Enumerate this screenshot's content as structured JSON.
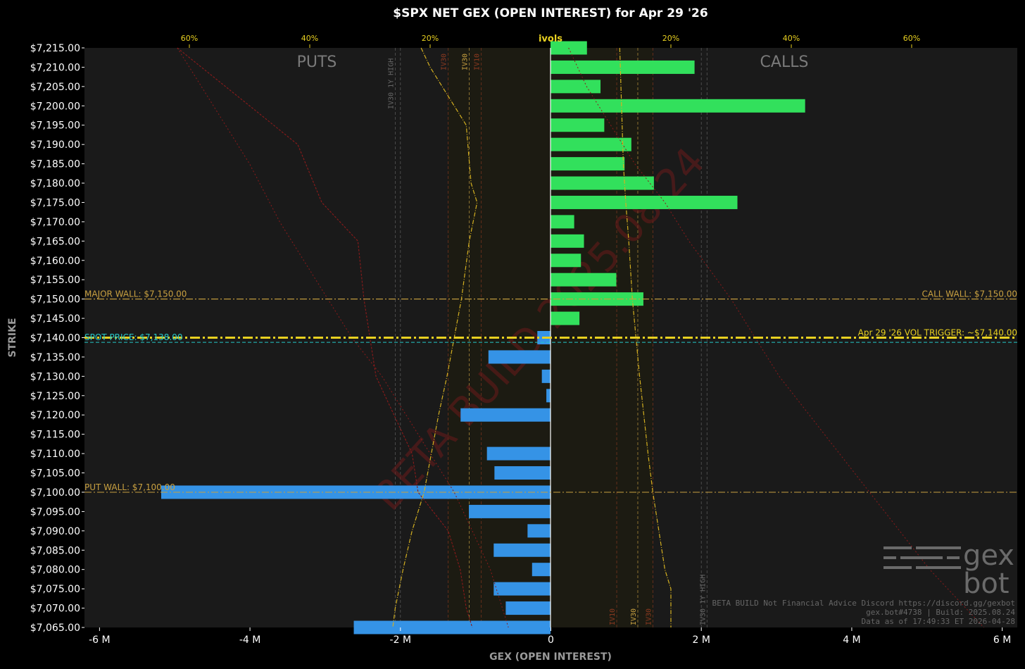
{
  "chart_data": {
    "type": "bar",
    "orientation": "horizontal",
    "title": "$SPX NET GEX (OPEN INTEREST) for Apr 29 '26",
    "xlabel": "GEX (OPEN INTEREST)",
    "ylabel": "STRIKE",
    "xlim": [
      -6200000,
      6200000
    ],
    "xticks": [
      -6000000,
      -4000000,
      -2000000,
      0,
      2000000,
      4000000,
      6000000
    ],
    "xtick_labels": [
      "-6 M",
      "-4 M",
      "-2 M",
      "0",
      "2 M",
      "4 M",
      "6 M"
    ],
    "ylim": [
      7065,
      7215
    ],
    "strike_step": 5,
    "grid": false,
    "side_labels": {
      "left": "PUTS",
      "right": "CALLS"
    },
    "top_axis": {
      "title": "ivols",
      "ticks": [
        {
          "iv": -0.6,
          "label": "60%"
        },
        {
          "iv": -0.4,
          "label": "40%"
        },
        {
          "iv": -0.2,
          "label": "20%"
        },
        {
          "iv": 0.2,
          "label": "20%"
        },
        {
          "iv": 0.4,
          "label": "40%"
        },
        {
          "iv": 0.6,
          "label": "60%"
        }
      ]
    },
    "series": [
      {
        "strikes": [
          7215,
          7210,
          7205,
          7200,
          7195,
          7190,
          7185,
          7180,
          7175,
          7170,
          7165,
          7160,
          7155,
          7150,
          7145,
          7140,
          7135,
          7130,
          7125,
          7120,
          7115,
          7110,
          7105,
          7100,
          7095,
          7090,
          7085,
          7080,
          7075,
          7070,
          7065
        ],
        "values": [
          480000,
          1910000,
          660000,
          3380000,
          710000,
          1070000,
          980000,
          1370000,
          2480000,
          310000,
          440000,
          400000,
          870000,
          1230000,
          380000,
          -180000,
          -830000,
          -120000,
          -60000,
          -1200000,
          0,
          -850000,
          -750000,
          -5180000,
          -1090000,
          -310000,
          -760000,
          -250000,
          -760000,
          -600000,
          -2620000
        ],
        "positive_color": "#32e05c",
        "negative_color": "#3593e6"
      }
    ],
    "levels": [
      {
        "label": "MAJOR WALL: $7,150.00",
        "strike": 7150,
        "side": "left",
        "color": "#c8a040"
      },
      {
        "label": "CALL WALL: $7,150.00",
        "strike": 7150,
        "side": "right",
        "color": "#c8a040"
      },
      {
        "label": "Apr 29 '26 VOL TRIGGER: ~$7,140.00",
        "strike": 7140,
        "side": "right",
        "color": "#e8d020"
      },
      {
        "label": "SPOT PRICE: $7,138.00",
        "strike": 7138.8,
        "side": "left",
        "color": "#25c8c8"
      },
      {
        "label": "PUT WALL: $7,100.00",
        "strike": 7100,
        "side": "left",
        "color": "#c8a040"
      }
    ],
    "iv_curves": {
      "call_ivol": [
        [
          7215,
          0.03
        ],
        [
          7205,
          0.06
        ],
        [
          7195,
          0.1
        ],
        [
          7185,
          0.14
        ],
        [
          7175,
          0.19
        ],
        [
          7165,
          0.23
        ],
        [
          7150,
          0.3
        ],
        [
          7140,
          0.34
        ],
        [
          7130,
          0.38
        ],
        [
          7120,
          0.43
        ],
        [
          7110,
          0.48
        ],
        [
          7100,
          0.53
        ],
        [
          7090,
          0.58
        ],
        [
          7080,
          0.63
        ],
        [
          7070,
          0.69
        ],
        [
          7065,
          0.72
        ]
      ],
      "put_ivol": [
        [
          7215,
          -0.62
        ],
        [
          7200,
          -0.56
        ],
        [
          7185,
          -0.5
        ],
        [
          7170,
          -0.45
        ],
        [
          7160,
          -0.41
        ],
        [
          7150,
          -0.37
        ],
        [
          7140,
          -0.33
        ],
        [
          7130,
          -0.28
        ],
        [
          7120,
          -0.24
        ],
        [
          7110,
          -0.2
        ],
        [
          7100,
          -0.16
        ],
        [
          7090,
          -0.13
        ],
        [
          7080,
          -0.1
        ],
        [
          7065,
          -0.07
        ]
      ],
      "skew_left": [
        [
          7215,
          -0.215
        ],
        [
          7210,
          -0.2
        ],
        [
          7195,
          -0.14
        ],
        [
          7180,
          -0.132
        ],
        [
          7175,
          -0.122
        ],
        [
          7165,
          -0.135
        ],
        [
          7150,
          -0.148
        ],
        [
          7140,
          -0.16
        ],
        [
          7130,
          -0.172
        ],
        [
          7120,
          -0.186
        ],
        [
          7110,
          -0.198
        ],
        [
          7100,
          -0.21
        ],
        [
          7090,
          -0.23
        ],
        [
          7080,
          -0.245
        ],
        [
          7070,
          -0.258
        ],
        [
          7065,
          -0.262
        ]
      ],
      "skew_right": [
        [
          7215,
          0.115
        ],
        [
          7200,
          0.118
        ],
        [
          7185,
          0.121
        ],
        [
          7175,
          0.125
        ],
        [
          7165,
          0.13
        ],
        [
          7150,
          0.136
        ],
        [
          7140,
          0.142
        ],
        [
          7130,
          0.148
        ],
        [
          7120,
          0.155
        ],
        [
          7110,
          0.162
        ],
        [
          7100,
          0.17
        ],
        [
          7090,
          0.18
        ],
        [
          7080,
          0.19
        ],
        [
          7075,
          0.2
        ],
        [
          7065,
          0.2
        ]
      ],
      "put_skew_left": [
        [
          7215,
          -0.62
        ],
        [
          7200,
          -0.5
        ],
        [
          7190,
          -0.42
        ],
        [
          7175,
          -0.38
        ],
        [
          7165,
          -0.32
        ],
        [
          7150,
          -0.31
        ],
        [
          7140,
          -0.3
        ],
        [
          7130,
          -0.29
        ],
        [
          7120,
          -0.26
        ],
        [
          7110,
          -0.23
        ],
        [
          7100,
          -0.22
        ],
        [
          7090,
          -0.17
        ],
        [
          7080,
          -0.15
        ],
        [
          7070,
          -0.14
        ],
        [
          7065,
          -0.13
        ]
      ]
    },
    "vlines_left": [
      {
        "iv": -0.258,
        "label": "IV30 1Y HIGH",
        "color": "#666666"
      },
      {
        "iv": -0.17,
        "label": "IV30",
        "color": "#8c3a20"
      },
      {
        "iv": -0.135,
        "label": "IV30",
        "color": "#c8a040"
      },
      {
        "iv": -0.115,
        "label": "IV10",
        "color": "#8c3a20"
      }
    ],
    "vlines_right": [
      {
        "iv": 0.11,
        "label": "IV10",
        "color": "#8c3a20"
      },
      {
        "iv": 0.145,
        "label": "IV30",
        "color": "#c8a040"
      },
      {
        "iv": 0.17,
        "label": "IV30",
        "color": "#8c3a20"
      },
      {
        "iv": 0.26,
        "label": "IV30 1Y HIGH",
        "color": "#666666"
      }
    ],
    "watermark": "BETA BUILD 2025.08.24",
    "logo_text": [
      "gex",
      "bot"
    ],
    "footer_lines": [
      "BETA BUILD Not Financial Advice Discord https://discord.gg/gexbot",
      "gex.bot#4738 | Build: 2025.08.24",
      "Data as of 17:49:33 ET 2026-04-28"
    ]
  }
}
